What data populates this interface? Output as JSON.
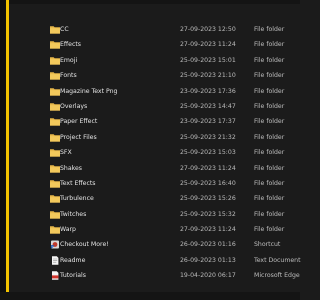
{
  "colors": {
    "accent": "#f2c200",
    "folder": "#e8b84a",
    "background": "#1b1b1b"
  },
  "files": [
    {
      "name": "CC",
      "date": "27-09-2023 12:50",
      "type": "File folder",
      "icon": "folder-icon"
    },
    {
      "name": "Effects",
      "date": "27-09-2023 11:24",
      "type": "File folder",
      "icon": "folder-icon"
    },
    {
      "name": "Emoji",
      "date": "25-09-2023 15:01",
      "type": "File folder",
      "icon": "folder-icon"
    },
    {
      "name": "Fonts",
      "date": "25-09-2023 21:10",
      "type": "File folder",
      "icon": "folder-icon"
    },
    {
      "name": "Magazine Text Png",
      "date": "23-09-2023 17:36",
      "type": "File folder",
      "icon": "folder-icon"
    },
    {
      "name": "Overlays",
      "date": "25-09-2023 14:47",
      "type": "File folder",
      "icon": "folder-icon"
    },
    {
      "name": "Paper Effect",
      "date": "23-09-2023 17:37",
      "type": "File folder",
      "icon": "folder-icon"
    },
    {
      "name": "Project Files",
      "date": "25-09-2023 21:32",
      "type": "File folder",
      "icon": "folder-icon"
    },
    {
      "name": "SFX",
      "date": "25-09-2023 15:03",
      "type": "File folder",
      "icon": "folder-icon"
    },
    {
      "name": "Shakes",
      "date": "27-09-2023 11:24",
      "type": "File folder",
      "icon": "folder-icon"
    },
    {
      "name": "Text Effects",
      "date": "25-09-2023 16:40",
      "type": "File folder",
      "icon": "folder-icon"
    },
    {
      "name": "Turbulence",
      "date": "25-09-2023 15:26",
      "type": "File folder",
      "icon": "folder-icon"
    },
    {
      "name": "Twitches",
      "date": "25-09-2023 15:32",
      "type": "File folder",
      "icon": "folder-icon"
    },
    {
      "name": "Warp",
      "date": "27-09-2023 11:24",
      "type": "File folder",
      "icon": "folder-icon"
    },
    {
      "name": "Checkout More!",
      "date": "26-09-2023 01:16",
      "type": "Shortcut",
      "icon": "shortcut-icon"
    },
    {
      "name": "Readme",
      "date": "26-09-2023 01:13",
      "type": "Text Document",
      "icon": "text-document-icon"
    },
    {
      "name": "Tutorials",
      "date": "19-04-2020 06:17",
      "type": "Microsoft Edge PDF",
      "icon": "pdf-icon"
    }
  ]
}
